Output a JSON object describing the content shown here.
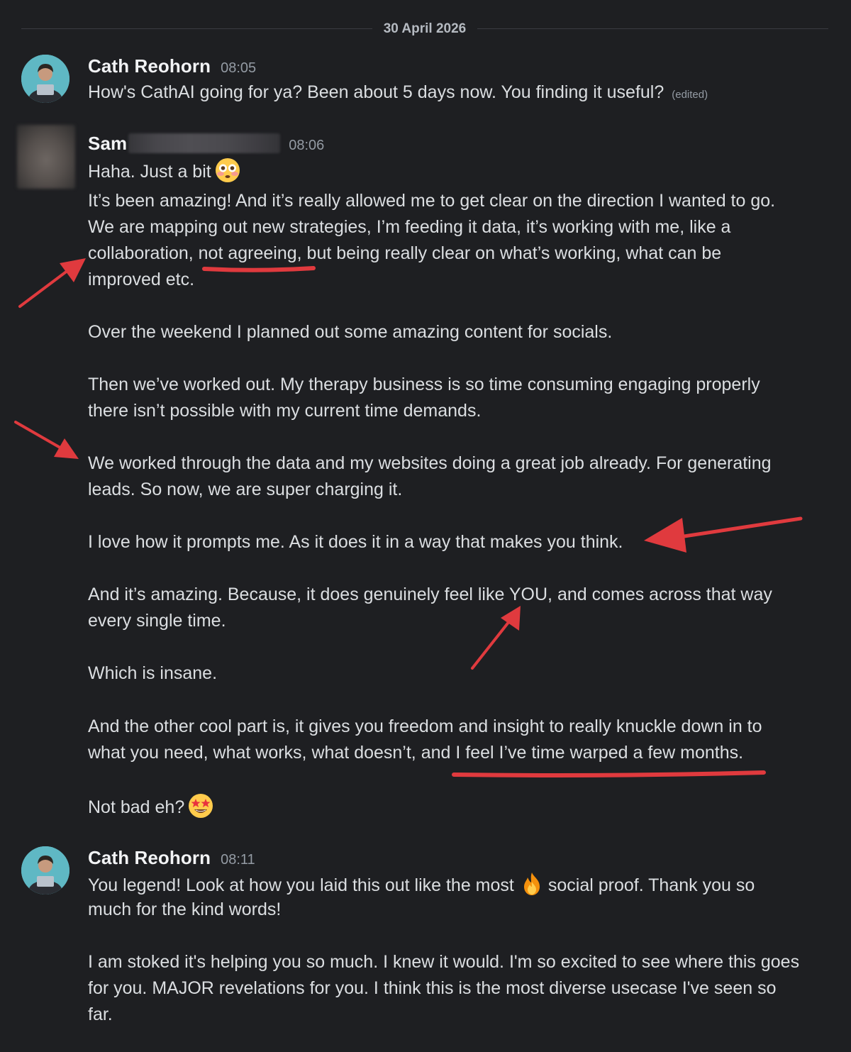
{
  "date_divider": "30 April 2026",
  "messages": [
    {
      "author": "Cath Reohorn",
      "time": "08:05",
      "lines": [
        "How's CathAI going for ya? Been about 5 days now. You finding it useful?"
      ],
      "edited_label": "(edited)"
    },
    {
      "author": "Sam",
      "time": "08:06",
      "lines": [
        "Haha. Just a bit",
        "It’s been amazing! And it’s really allowed me to get clear on the direction I wanted to go.",
        "We are mapping out new strategies, I’m feeding it data, it’s working with me, like a",
        "collaboration, not agreeing, but being really clear on what’s working, what can be",
        "improved etc.",
        "Over the weekend I planned out some amazing content for socials.",
        "Then we’ve worked out. My therapy business is so time consuming engaging properly",
        "there isn’t possible with my current time demands.",
        "We worked through the data and my websites doing a great job already. For generating",
        "leads. So now, we are super charging it.",
        "I love how it prompts me. As it does it in a way that makes you think.",
        "And it’s amazing. Because, it does genuinely feel like YOU, and comes across that way",
        "every single time.",
        "Which is insane.",
        "And the other cool part is, it gives you freedom and insight to really knuckle down in to",
        "what you need, what works, what doesn’t, and I feel I’ve time warped a few months.",
        "Not bad eh?"
      ]
    },
    {
      "author": "Cath Reohorn",
      "time": "08:11",
      "lines": [
        "You legend! Look at how you laid this out like the most",
        "social proof. Thank you so",
        "much for the kind words!",
        "I am stoked it's helping you so much. I knew it would. I'm so excited to see where this goes",
        "for you. MAJOR revelations for you. I think this is the most diverse usecase I've seen so",
        "far."
      ]
    }
  ],
  "emojis": [
    "flushed-face",
    "star-struck",
    "fire"
  ],
  "colors": {
    "background": "#1e1f22",
    "text": "#dbdee1",
    "timestamp": "#949ba4",
    "annotation": "#e03a3e",
    "avatar": "#5fb8c4"
  }
}
